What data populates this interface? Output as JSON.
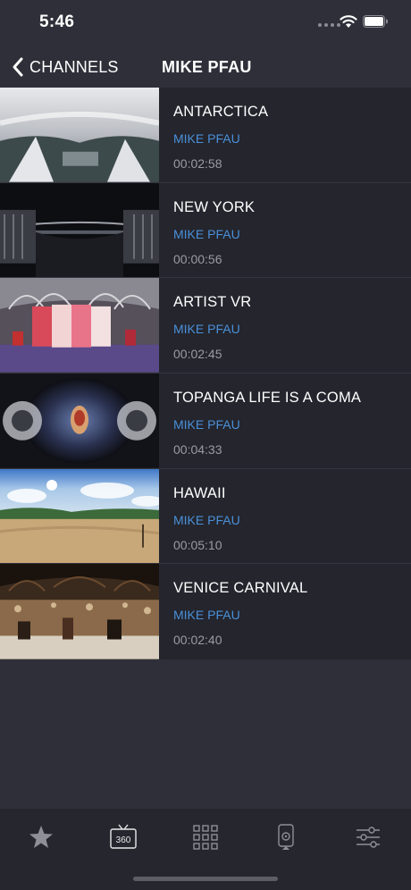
{
  "status": {
    "time": "5:46"
  },
  "nav": {
    "back_label": "CHANNELS",
    "title": "MIKE PFAU"
  },
  "videos": [
    {
      "title": "ANTARCTICA",
      "channel": "MIKE PFAU",
      "duration": "00:02:58"
    },
    {
      "title": "NEW YORK",
      "channel": "MIKE PFAU",
      "duration": "00:00:56"
    },
    {
      "title": "ARTIST VR",
      "channel": "MIKE PFAU",
      "duration": "00:02:45"
    },
    {
      "title": "TOPANGA LIFE IS A COMA",
      "channel": "MIKE PFAU",
      "duration": "00:04:33"
    },
    {
      "title": "HAWAII",
      "channel": "MIKE PFAU",
      "duration": "00:05:10"
    },
    {
      "title": "VENICE CARNIVAL",
      "channel": "MIKE PFAU",
      "duration": "00:02:40"
    }
  ],
  "tabs": [
    {
      "icon": "star-icon"
    },
    {
      "icon": "tv-360-icon",
      "label": "360",
      "active": true
    },
    {
      "icon": "grid-icon"
    },
    {
      "icon": "device-icon"
    },
    {
      "icon": "sliders-icon"
    }
  ],
  "colors": {
    "background": "#2e2f38",
    "row_background": "#24252d",
    "accent": "#4a90d9"
  }
}
